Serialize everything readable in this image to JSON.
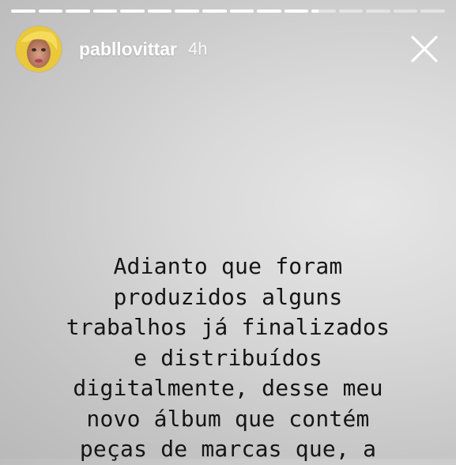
{
  "story": {
    "progress": {
      "segment_count": 16,
      "completed_segments": 11,
      "current_segment_fraction": 0.3
    },
    "user": {
      "username": "pabllovittar",
      "timestamp": "4h",
      "avatar": "profile-photo"
    },
    "close_icon": "close-icon",
    "caption_lines": [
      "Adianto que foram",
      "produzidos alguns",
      "trabalhos já finalizados",
      "e distribuídos",
      "digitalmente, desse meu",
      "novo álbum que contém",
      "peças de marcas que, a"
    ]
  }
}
